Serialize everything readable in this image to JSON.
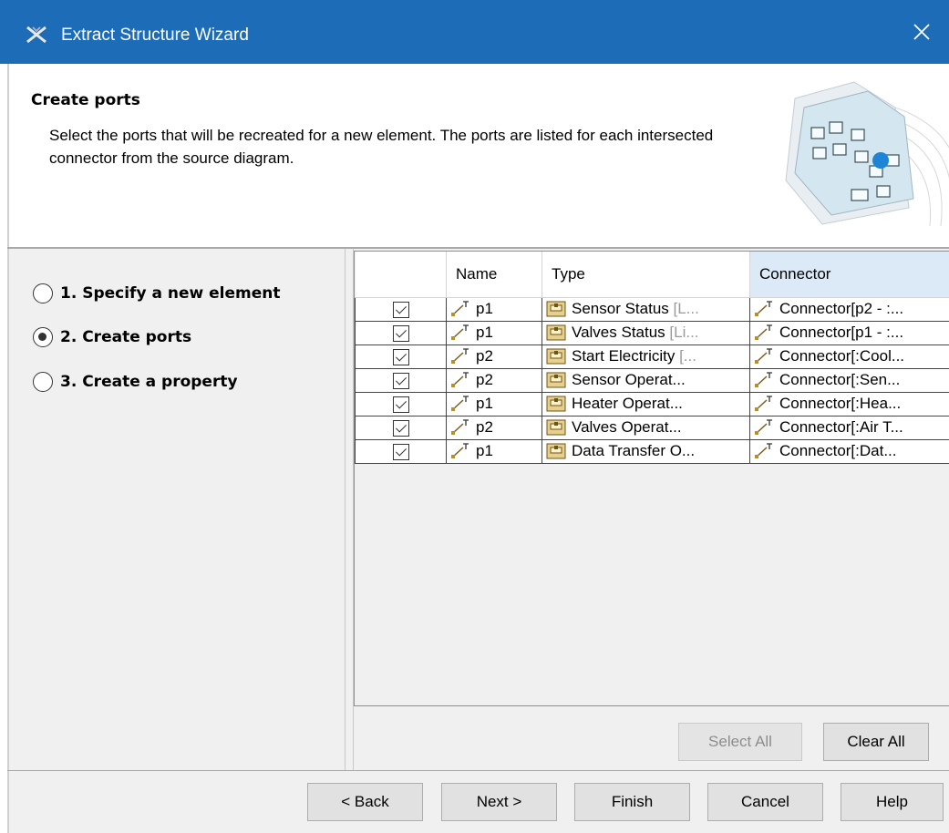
{
  "window": {
    "title": "Extract Structure Wizard"
  },
  "header": {
    "title": "Create ports",
    "description": "Select the ports that will be recreated for a new element. The ports are listed for each intersected connector from the source diagram."
  },
  "steps": [
    {
      "label": "1. Specify a new element",
      "selected": false
    },
    {
      "label": "2. Create ports",
      "selected": true
    },
    {
      "label": "3. Create a property",
      "selected": false
    }
  ],
  "table": {
    "columns": [
      "",
      "Name",
      "Type",
      "Connector"
    ],
    "rows": [
      {
        "checked": true,
        "name": "p1",
        "type": "Sensor Status",
        "type_suffix": " [L...",
        "connector": "Connector[p2 - :..."
      },
      {
        "checked": true,
        "name": "p1",
        "type": "Valves Status",
        "type_suffix": " [Li...",
        "connector": "Connector[p1 - :..."
      },
      {
        "checked": true,
        "name": "p2",
        "type": "Start Electricity",
        "type_suffix": " [...",
        "connector": "Connector[:Cool..."
      },
      {
        "checked": true,
        "name": "p2",
        "type": "Sensor Operat...",
        "type_suffix": "",
        "connector": "Connector[:Sen..."
      },
      {
        "checked": true,
        "name": "p1",
        "type": "Heater Operat...",
        "type_suffix": "",
        "connector": "Connector[:Hea..."
      },
      {
        "checked": true,
        "name": "p2",
        "type": "Valves Operat...",
        "type_suffix": "",
        "connector": "Connector[:Air T..."
      },
      {
        "checked": true,
        "name": "p1",
        "type": "Data Transfer O...",
        "type_suffix": "",
        "connector": "Connector[:Dat..."
      }
    ]
  },
  "buttons": {
    "select_all": "Select All",
    "clear_all": "Clear All",
    "back": "< Back",
    "next": "Next >",
    "finish": "Finish",
    "cancel": "Cancel",
    "help": "Help"
  },
  "icons": {
    "title": "wizard-icon",
    "close": "close-icon",
    "port": "port-icon",
    "type": "block-type-icon",
    "connector": "connector-icon"
  },
  "colors": {
    "titlebar": "#1c6cb8",
    "active_column": "#dce9f7"
  }
}
